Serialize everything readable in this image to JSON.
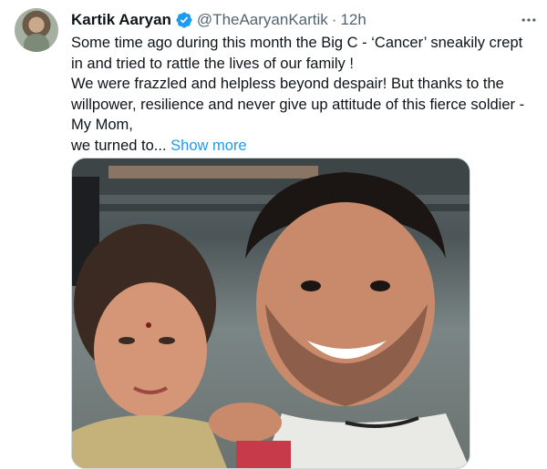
{
  "author": {
    "display_name": "Kartik Aaryan",
    "handle": "@TheAaryanKartik",
    "separator": "·",
    "timestamp": "12h",
    "verified": true
  },
  "tweet": {
    "lines": [
      "Some time ago during this month the Big C - ‘Cancer’ sneakily crept in and tried to rattle the lives of our family !",
      "We were frazzled and helpless beyond despair! But thanks to the willpower, resilience and never give up attitude of this fierce soldier - My Mom,",
      "we turned to..."
    ],
    "show_more_label": "Show more"
  },
  "icons": {
    "verified": "verified-badge-icon",
    "more": "more-options-icon"
  },
  "colors": {
    "accent": "#1d9bf0",
    "text": "#0f1419",
    "secondary": "#536471"
  }
}
